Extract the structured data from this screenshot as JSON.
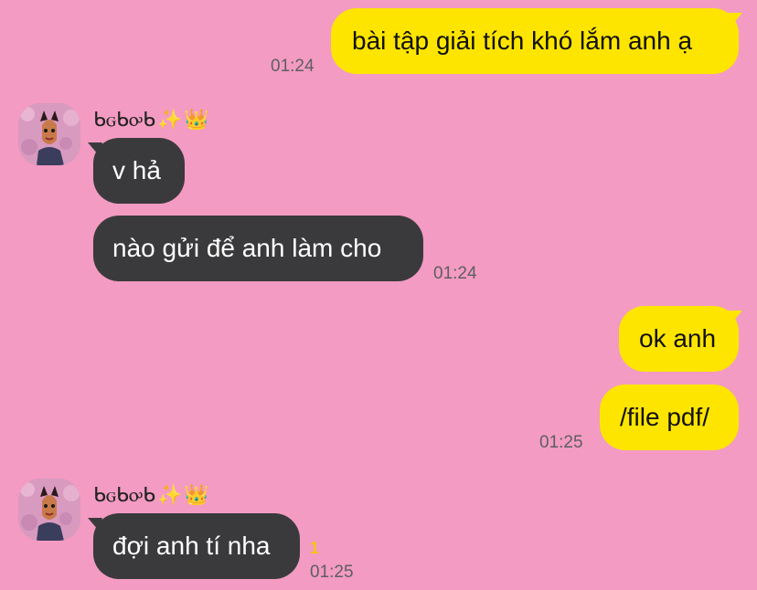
{
  "colors": {
    "background": "#F39BC2",
    "my_bubble": "#FEE500",
    "their_bubble": "#3A3A3C",
    "timestamp": "#5E5E66",
    "unread": "#F5C518"
  },
  "messages": {
    "m1": {
      "text": "bài tập giải tích khó lắm anh ạ",
      "time": "01:24"
    },
    "sender1": {
      "name": "ᑲꮐᑲꭴᑲ",
      "icons": [
        "sparkles-icon",
        "crown-icon"
      ]
    },
    "m2": {
      "text": "v hả"
    },
    "m3": {
      "text": "nào gửi để anh làm cho",
      "time": "01:24"
    },
    "m4": {
      "text": "ok anh"
    },
    "m5": {
      "text": "/file pdf/",
      "time": "01:25"
    },
    "sender2": {
      "name": "ᑲꮐᑲꭴᑲ",
      "icons": [
        "sparkles-icon",
        "crown-icon"
      ]
    },
    "m6": {
      "text": "đợi anh tí nha",
      "time": "01:25",
      "unread": "1"
    }
  }
}
